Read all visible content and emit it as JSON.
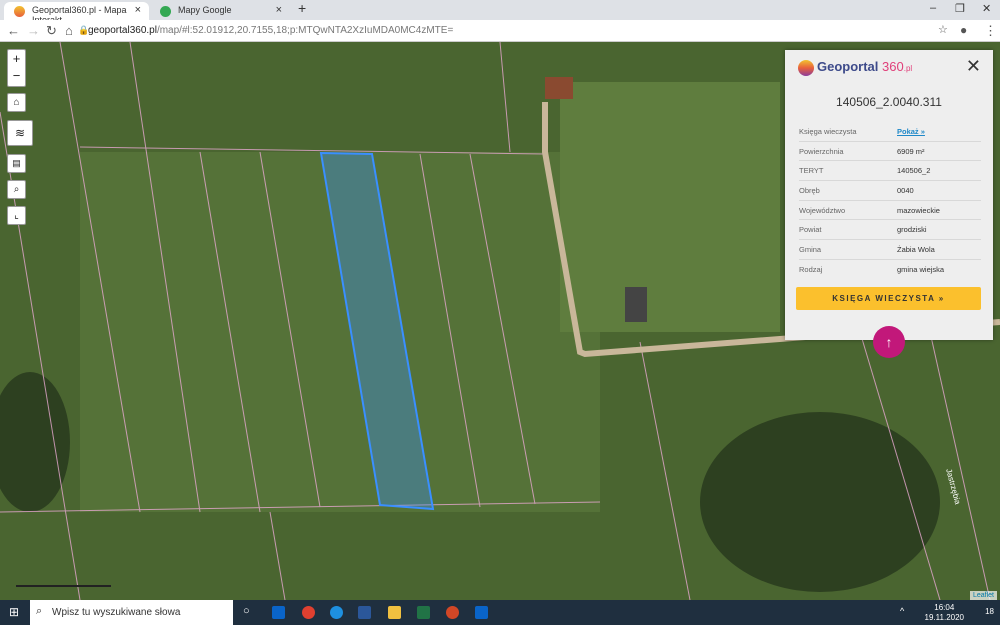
{
  "browser": {
    "tabs": [
      {
        "label": "Geoportal360.pl - Mapa Interakt",
        "active": true
      },
      {
        "label": "Mapy Google",
        "active": false
      }
    ],
    "url_host": "geoportal360.pl",
    "url_path": "/map/#l:52.01912,20.7155,18;p:MTQwNTA2XzIuMDA0MC4zMTE="
  },
  "map": {
    "controls": {
      "zoom_in": "+",
      "zoom_out": "−"
    },
    "attribution": "Leaflet",
    "road_label": "Jastrzębia",
    "selected_parcel_color": "#3a8fff"
  },
  "panel": {
    "logo": "Geoportal",
    "logo_num": "360",
    "logo_suffix": ".pl",
    "title": "140506_2.0040.311",
    "rows": [
      {
        "k": "Księga wieczysta",
        "v": "Pokaż »",
        "link": true
      },
      {
        "k": "Powierzchnia",
        "v": "6909 m²"
      },
      {
        "k": "TERYT",
        "v": "140506_2"
      },
      {
        "k": "Obręb",
        "v": "0040"
      },
      {
        "k": "Województwo",
        "v": "mazowieckie"
      },
      {
        "k": "Powiat",
        "v": "grodziski"
      },
      {
        "k": "Gmina",
        "v": "Żabia Wola"
      },
      {
        "k": "Rodzaj",
        "v": "gmina wiejska"
      }
    ],
    "button": "KSIĘGA WIECZYSTA »",
    "accent": "#fbc02d"
  },
  "taskbar": {
    "search_placeholder": "Wpisz tu wyszukiwane słowa",
    "time": "16:04",
    "date": "19.11.2020",
    "notifications": "18"
  }
}
